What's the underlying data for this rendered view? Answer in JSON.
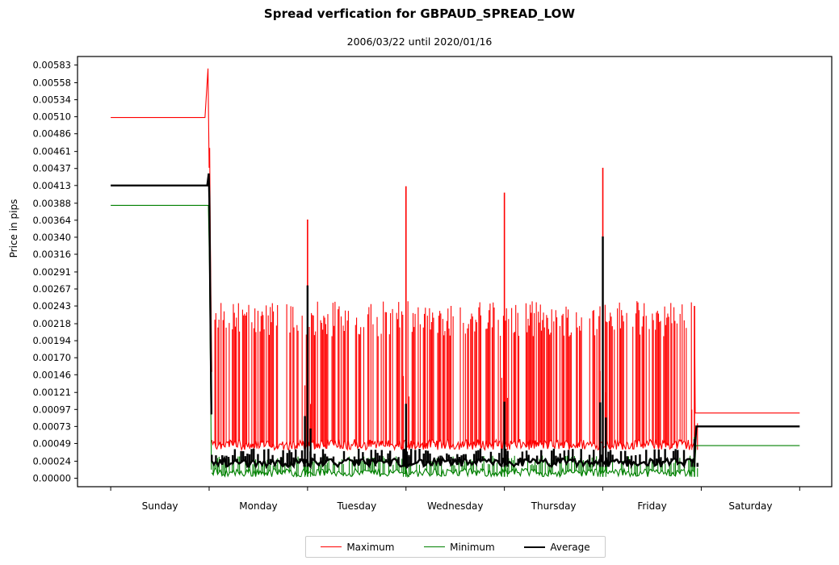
{
  "chart_data": {
    "type": "line",
    "title": "Spread verfication for GBPAUD_SPREAD_LOW",
    "subtitle": "2006/03/22 until 2020/01/16",
    "xlabel": "",
    "ylabel": "Price in pips",
    "legend_position": "bottom-center",
    "grid": false,
    "xlim": [
      0,
      1
    ],
    "ylim": [
      -0.00012,
      0.00595
    ],
    "ytick_labels": [
      "0.00583",
      "0.00558",
      "0.00534",
      "0.00510",
      "0.00486",
      "0.00461",
      "0.00437",
      "0.00413",
      "0.00388",
      "0.00364",
      "0.00340",
      "0.00316",
      "0.00291",
      "0.00267",
      "0.00243",
      "0.00218",
      "0.00194",
      "0.00170",
      "0.00146",
      "0.00121",
      "0.00097",
      "0.00073",
      "0.00049",
      "0.00024",
      "0.00000"
    ],
    "ytick_values": [
      0.00583,
      0.00558,
      0.00534,
      0.0051,
      0.00486,
      0.00461,
      0.00437,
      0.00413,
      0.00388,
      0.00364,
      0.0034,
      0.00316,
      0.00291,
      0.00267,
      0.00243,
      0.00218,
      0.00194,
      0.0017,
      0.00146,
      0.00121,
      0.00097,
      0.00073,
      0.00049,
      0.00024,
      0.0
    ],
    "xtick_labels": [
      "Sunday",
      "Monday",
      "Tuesday",
      "Wednesday",
      "Thursday",
      "Friday",
      "Saturday"
    ],
    "xtick_positions": [
      0.044,
      0.1745,
      0.305,
      0.4355,
      0.566,
      0.6965,
      0.827,
      0.9575
    ],
    "xlabel_positions": [
      0.1093,
      0.2398,
      0.3703,
      0.5008,
      0.6313,
      0.7618,
      0.8923
    ],
    "series": [
      {
        "name": "Maximum",
        "color": "#ff0000",
        "width": 1.1,
        "segments": [
          {
            "name": "weekend-open-flat",
            "points": [
              [
                0.044,
                0.00509
              ],
              [
                0.169,
                0.00509
              ],
              [
                0.173,
                0.00578
              ],
              [
                0.1745,
                0.00438
              ],
              [
                0.1752,
                0.00466
              ],
              [
                0.176,
                0.0035
              ],
              [
                0.1768,
                0.00262
              ],
              [
                0.178,
                0.0015
              ]
            ]
          },
          {
            "name": "weekday-dense-band",
            "baseline_low": 0.0004,
            "baseline_high": 0.00055,
            "spike_low": 0.002,
            "spike_high": 0.0025,
            "start": 0.178,
            "end": 0.818,
            "density": 470,
            "day_boundaries": [
              {
                "x": 0.305,
                "peak": 0.00365
              },
              {
                "x": 0.4355,
                "peak": 0.00412
              },
              {
                "x": 0.566,
                "peak": 0.00403
              },
              {
                "x": 0.6965,
                "peak": 0.00438
              },
              {
                "x": 0.818,
                "peak": 0.00243
              }
            ]
          },
          {
            "name": "weekend-close-flat",
            "points": [
              [
                0.818,
                0.00243
              ],
              [
                0.819,
                0.00092
              ],
              [
                0.9575,
                0.00092
              ]
            ]
          }
        ]
      },
      {
        "name": "Minimum",
        "color": "#008000",
        "width": 1.1,
        "segments": [
          {
            "name": "weekend-open-flat",
            "points": [
              [
                0.044,
                0.00385
              ],
              [
                0.1735,
                0.00385
              ],
              [
                0.175,
                0.003
              ],
              [
                0.1775,
                0.00012
              ]
            ]
          },
          {
            "name": "weekday-dense-band",
            "baseline_low": 2e-05,
            "baseline_high": 0.00014,
            "spike_low": 0.00018,
            "spike_high": 0.00032,
            "start": 0.178,
            "end": 0.818,
            "density": 330,
            "day_boundaries": [
              {
                "x": 0.305,
                "peak": 0.00055
              },
              {
                "x": 0.4355,
                "peak": 0.0006
              },
              {
                "x": 0.566,
                "peak": 0.00062
              },
              {
                "x": 0.6965,
                "peak": 0.0007
              },
              {
                "x": 0.818,
                "peak": 0.00058
              }
            ]
          },
          {
            "name": "weekend-close-flat",
            "points": [
              [
                0.818,
                0.0001
              ],
              [
                0.82,
                0.00046
              ],
              [
                0.9575,
                0.00046
              ]
            ]
          }
        ]
      },
      {
        "name": "Average",
        "color": "#000000",
        "width": 2.4,
        "segments": [
          {
            "name": "weekend-open-flat",
            "points": [
              [
                0.044,
                0.00413
              ],
              [
                0.172,
                0.00413
              ],
              [
                0.174,
                0.0043
              ],
              [
                0.1748,
                0.00395
              ],
              [
                0.176,
                0.0025
              ],
              [
                0.1775,
                0.0009
              ]
            ]
          },
          {
            "name": "weekday-dense-band",
            "baseline_low": 0.00016,
            "baseline_high": 0.00028,
            "spike_low": 0.00026,
            "spike_high": 0.00042,
            "start": 0.178,
            "end": 0.818,
            "density": 230,
            "day_boundaries": [
              {
                "x": 0.305,
                "peak": 0.00272
              },
              {
                "x": 0.4355,
                "peak": 0.00105
              },
              {
                "x": 0.566,
                "peak": 0.00108
              },
              {
                "x": 0.6965,
                "peak": 0.00341
              },
              {
                "x": 0.818,
                "peak": 0.00055
              }
            ]
          },
          {
            "name": "weekend-close-flat",
            "points": [
              [
                0.818,
                0.0003
              ],
              [
                0.8205,
                0.00073
              ],
              [
                0.9575,
                0.00073
              ]
            ]
          }
        ]
      }
    ]
  },
  "legend": {
    "items": [
      {
        "label": "Maximum",
        "color": "#ff0000",
        "width": 1.2
      },
      {
        "label": "Minimum",
        "color": "#008000",
        "width": 1.2
      },
      {
        "label": "Average",
        "color": "#000000",
        "width": 2.6
      }
    ]
  },
  "axes": {
    "frame_color": "#000000",
    "background": "#ffffff"
  }
}
